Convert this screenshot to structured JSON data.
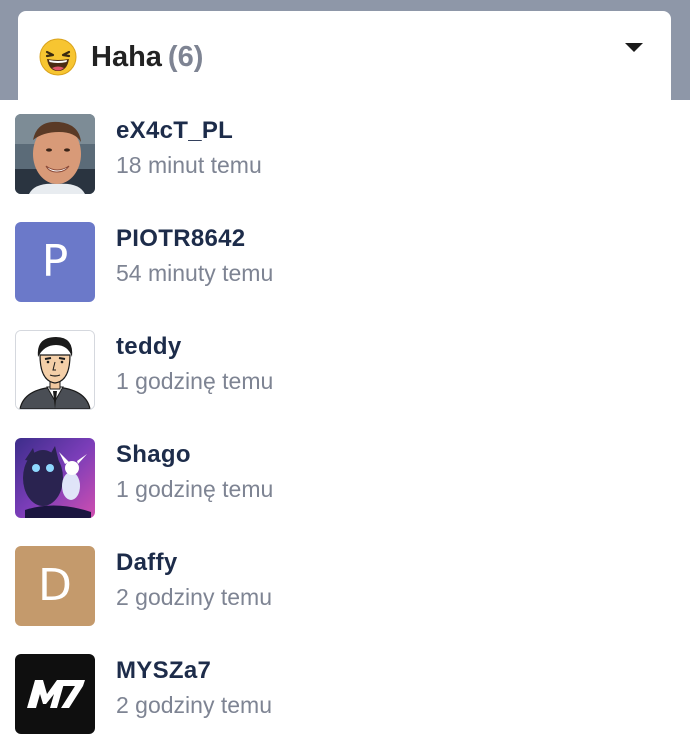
{
  "reactions_panel": {
    "reaction_name": "Haha",
    "reaction_count": "(6)",
    "reaction_emoji": "laughing-face",
    "users": [
      {
        "name": "eX4cT_PL",
        "time": "18 minut temu",
        "avatar": "photo"
      },
      {
        "name": "PIOTR8642",
        "time": "54 minuty temu",
        "avatar": "letter",
        "letter": "P",
        "color": "#6b79c9"
      },
      {
        "name": "teddy",
        "time": "1 godzinę temu",
        "avatar": "cartoon"
      },
      {
        "name": "Shago",
        "time": "1 godzinę temu",
        "avatar": "artwork"
      },
      {
        "name": "Daffy",
        "time": "2 godziny temu",
        "avatar": "letter",
        "letter": "D",
        "color": "#c49a6c"
      },
      {
        "name": "MYSZa7",
        "time": "2 godziny temu",
        "avatar": "logo",
        "logo_text": "M7"
      }
    ]
  }
}
